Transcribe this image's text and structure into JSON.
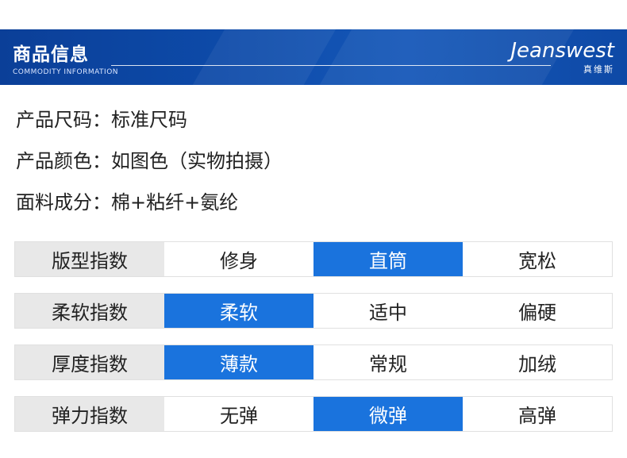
{
  "header": {
    "title": "商品信息",
    "subtitle": "COMMODITY INFORMATION",
    "brand": "Jeanswest",
    "brand_cn": "真维斯"
  },
  "info": [
    {
      "label": "产品尺码：",
      "value": "标准尺码"
    },
    {
      "label": "产品颜色：",
      "value": "如图色（实物拍摄）"
    },
    {
      "label": "面料成分：",
      "value": "棉+粘纤+氨纶"
    }
  ],
  "indices": [
    {
      "name": "版型指数",
      "options": [
        "修身",
        "直筒",
        "宽松"
      ],
      "selected": "直筒"
    },
    {
      "name": "柔软指数",
      "options": [
        "柔软",
        "适中",
        "偏硬"
      ],
      "selected": "柔软"
    },
    {
      "name": "厚度指数",
      "options": [
        "薄款",
        "常规",
        "加绒"
      ],
      "selected": "薄款"
    },
    {
      "name": "弹力指数",
      "options": [
        "无弹",
        "微弹",
        "高弹"
      ],
      "selected": "微弹"
    }
  ],
  "colors": {
    "accent": "#1a73dd",
    "banner": "#0d4aa8",
    "header_cell": "#e8e8e8"
  }
}
